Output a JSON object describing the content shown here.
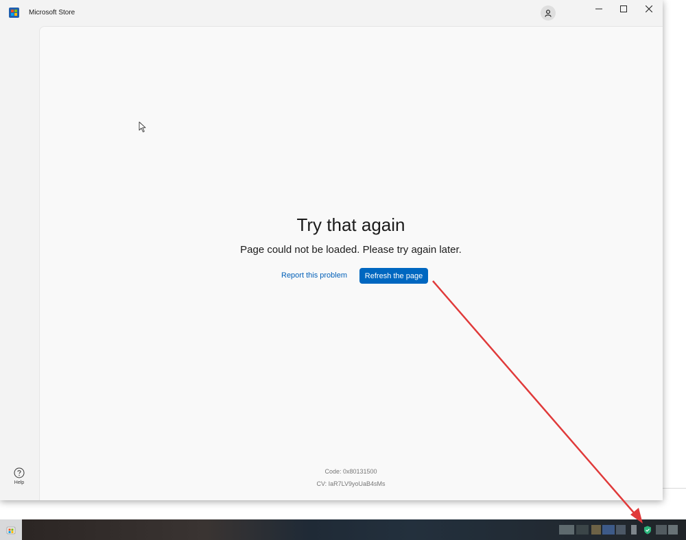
{
  "window": {
    "title": "Microsoft Store",
    "controls": [
      "minimize-icon",
      "maximize-icon",
      "close-icon"
    ]
  },
  "sidebar": {
    "help_label": "Help"
  },
  "error": {
    "title": "Try that again",
    "message": "Page could not be loaded. Please try again later.",
    "report_link": "Report this problem",
    "refresh_button": "Refresh the page",
    "code": "Code: 0x80131500",
    "cv": "CV: IaR7LV9yoUaB4sMs"
  },
  "colors": {
    "accent": "#0067c0",
    "link": "#005fb8",
    "annotation_arrow": "#e03a3a"
  }
}
